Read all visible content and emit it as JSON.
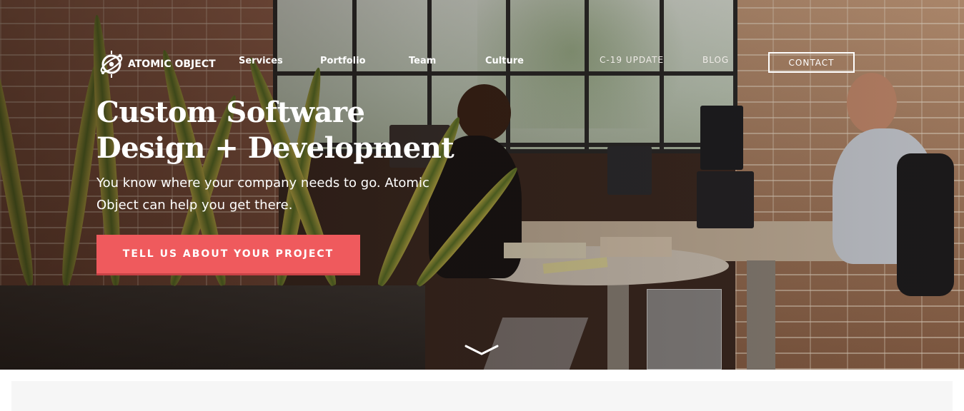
{
  "brand": {
    "name": "ATOMIC OBJECT",
    "logo_icon": "atom-logo-icon"
  },
  "nav": {
    "items": [
      {
        "label": "Services"
      },
      {
        "label": "Portfolio"
      },
      {
        "label": "Team"
      },
      {
        "label": "Culture"
      }
    ],
    "secondary": [
      {
        "label": "C-19 UPDATE"
      },
      {
        "label": "BLOG"
      }
    ],
    "contact_label": "CONTACT"
  },
  "hero": {
    "headline_line1": "Custom Software",
    "headline_line2": "Design + Development",
    "subtext": "You know where your company needs to go. Atomic Object can help you get there.",
    "cta_label": "TELL US ABOUT YOUR PROJECT",
    "scroll_icon": "chevron-down-icon"
  },
  "colors": {
    "cta": "#ef5a5d",
    "text": "#ffffff",
    "below_background": "#f6f6f6"
  }
}
